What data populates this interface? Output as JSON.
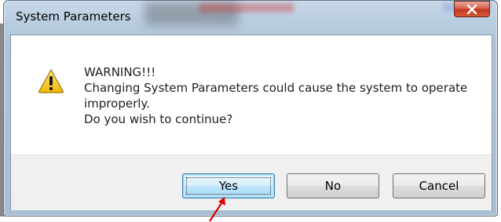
{
  "dialog": {
    "title": "System Parameters",
    "message": {
      "line1": "WARNING!!!",
      "line2": "Changing System Parameters could cause the system to operate",
      "line3": "improperly.",
      "line4": "Do you wish to continue?"
    },
    "buttons": {
      "yes": "Yes",
      "no": "No",
      "cancel": "Cancel"
    },
    "default_button": "yes",
    "icon": "warning-icon"
  },
  "colors": {
    "annotation_arrow": "#e00000",
    "close_button": "#c9452b",
    "focused_button_border": "#3c7fb1"
  }
}
